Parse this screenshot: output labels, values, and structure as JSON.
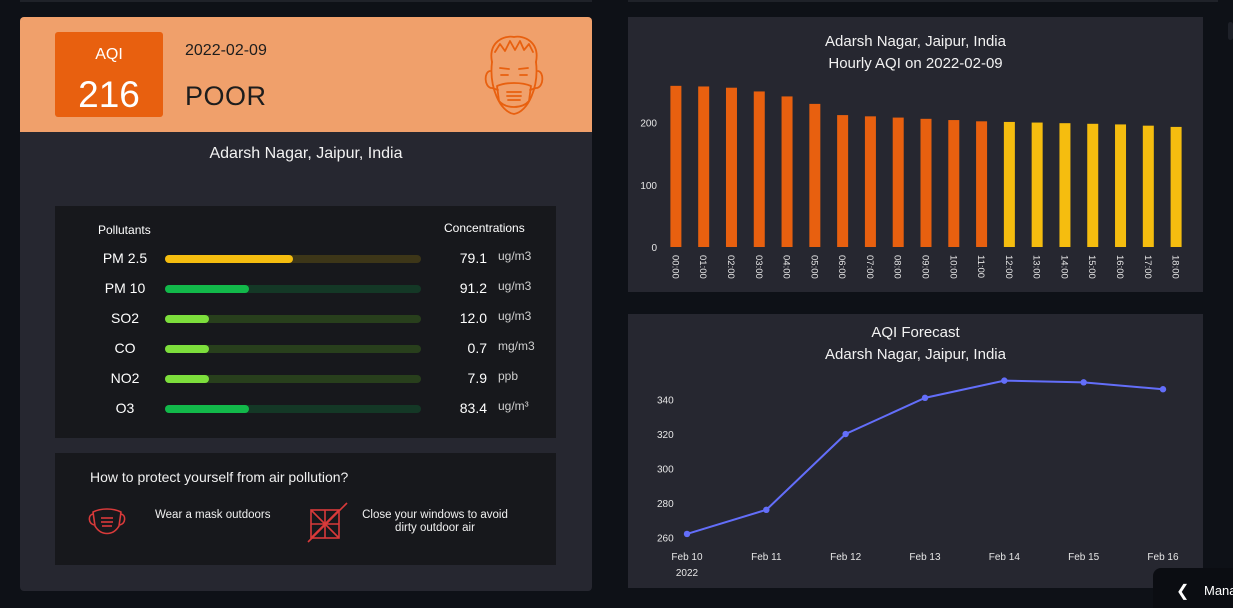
{
  "aqi_card": {
    "aqi_label": "AQI",
    "aqi_value": "216",
    "date": "2022-02-09",
    "category": "POOR",
    "location": "Adarsh Nagar, Jaipur, India",
    "header_color": "#f0a06b",
    "badge_color": "#e8600f"
  },
  "pollutants": {
    "header_left": "Pollutants",
    "header_right": "Concentrations",
    "rows": [
      {
        "name": "PM 2.5",
        "value": "79.1",
        "unit": "ug/m3",
        "level": 0.5,
        "color": "#f5bd0f",
        "track": "#3d3618"
      },
      {
        "name": "PM 10",
        "value": "91.2",
        "unit": "ug/m3",
        "level": 0.33,
        "color": "#12b84a",
        "track": "#143826"
      },
      {
        "name": "SO2",
        "value": "12.0",
        "unit": "ug/m3",
        "level": 0.17,
        "color": "#7dde3c",
        "track": "#283f1c"
      },
      {
        "name": "CO",
        "value": "0.7",
        "unit": "mg/m3",
        "level": 0.17,
        "color": "#7dde3c",
        "track": "#283f1c"
      },
      {
        "name": "NO2",
        "value": "7.9",
        "unit": "ppb",
        "level": 0.17,
        "color": "#7dde3c",
        "track": "#283f1c"
      },
      {
        "name": "O3",
        "value": "83.4",
        "unit": "ug/m³",
        "level": 0.33,
        "color": "#12b84a",
        "track": "#143826"
      }
    ]
  },
  "protection": {
    "title": "How to protect yourself from air pollution?",
    "tip_mask": "Wear a mask outdoors",
    "tip_window_line1": "Close your windows to avoid",
    "tip_window_line2": "dirty outdoor air"
  },
  "sidebar_toggle": {
    "label": "Mana"
  },
  "chart_data": [
    {
      "type": "bar",
      "title_line1": "Adarsh Nagar, Jaipur, India",
      "title_line2": "Hourly AQI on 2022-02-09",
      "categories": [
        "00:00",
        "01:00",
        "02:00",
        "03:00",
        "04:00",
        "05:00",
        "06:00",
        "07:00",
        "08:00",
        "09:00",
        "10:00",
        "11:00",
        "12:00",
        "13:00",
        "14:00",
        "15:00",
        "16:00",
        "17:00",
        "18:00"
      ],
      "values": [
        259,
        258,
        256,
        250,
        242,
        230,
        212,
        210,
        208,
        206,
        204,
        202,
        201,
        200,
        199,
        198,
        197,
        195,
        193
      ],
      "y_ticks": [
        0,
        100,
        200
      ],
      "ylim": [
        0,
        270
      ],
      "colors": {
        "poor": "#e8600f",
        "moderate": "#f5bd0f"
      },
      "color_threshold": 201
    },
    {
      "type": "line",
      "title_line1": "AQI Forecast",
      "title_line2": "Adarsh Nagar, Jaipur, India",
      "x": [
        "Feb 10",
        "Feb 11",
        "Feb 12",
        "Feb 13",
        "Feb 14",
        "Feb 15",
        "Feb 16"
      ],
      "x_year": "2022",
      "values": [
        262,
        276,
        320,
        341,
        351,
        350,
        346
      ],
      "y_ticks": [
        260,
        280,
        300,
        320,
        340
      ],
      "ylim": [
        255,
        356
      ],
      "color": "#636efa"
    }
  ]
}
